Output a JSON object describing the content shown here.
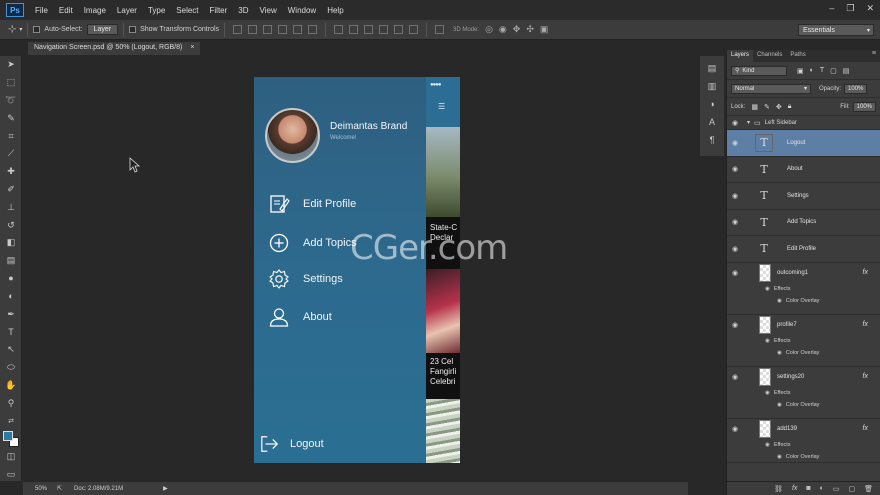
{
  "app": {
    "logo": "Ps",
    "menu": [
      "File",
      "Edit",
      "Image",
      "Layer",
      "Type",
      "Select",
      "Filter",
      "3D",
      "View",
      "Window",
      "Help"
    ]
  },
  "options_bar": {
    "auto_select_label": "Auto-Select:",
    "auto_select_value": "Layer",
    "transform_label": "Show Transform Controls",
    "mode_3d_label": "3D Mode:",
    "workspace": "Essentials"
  },
  "document": {
    "tab_title": "Navigation Screen.psd @ 50% (Logout, RGB/8)",
    "tab_close": "×"
  },
  "design": {
    "user_name": "Deimantas Brand",
    "user_status": "Welcome!",
    "nav": [
      "Edit Profile",
      "Add Topics",
      "Settings",
      "About"
    ],
    "logout": "Logout",
    "preview_texts": [
      "State-C",
      "Declar",
      "23 Cel",
      "Fangirli",
      "Celebri"
    ]
  },
  "watermark": "CGer.com",
  "layers_panel": {
    "tabs": [
      "Layers",
      "Channels",
      "Paths"
    ],
    "filter": "Kind",
    "blend_mode": "Normal",
    "opacity_label": "Opacity:",
    "opacity": "100%",
    "lock_label": "Lock:",
    "fill_label": "Fill:",
    "fill": "100%",
    "group_name": "Left Sidebar",
    "text_layers": [
      "Logout",
      "About",
      "Settings",
      "Add Topics",
      "Edit Profile"
    ],
    "fx_layers": [
      "outcoming1",
      "profile7",
      "settings20",
      "add139"
    ],
    "effects_label": "Effects",
    "color_overlay_label": "Color Overlay",
    "fx_badge": "fx"
  },
  "status_bar": {
    "zoom": "50%",
    "doc": "Doc: 2.08M/9.21M"
  }
}
